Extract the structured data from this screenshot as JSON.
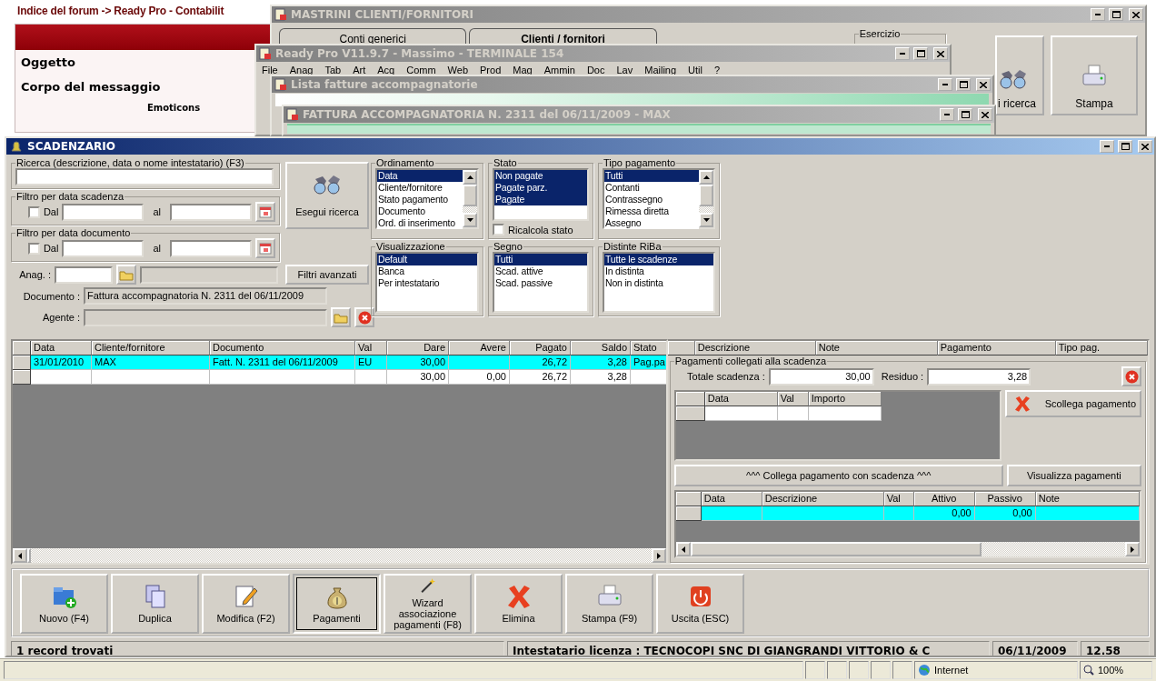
{
  "browser": {
    "breadcrumb": "Indice del forum -> Ready Pro - Contabilit",
    "form_labels": [
      "Oggetto",
      "Corpo del messaggio"
    ],
    "emoticons": "Emoticons",
    "status_zone": "Internet",
    "status_zoom": "100%"
  },
  "mastrini_window": {
    "title": "MASTRINI CLIENTI/FORNITORI",
    "active": false,
    "tabs": [
      {
        "label": "Conti generici",
        "selected": false
      },
      {
        "label": "Clienti / fornitori",
        "selected": true
      }
    ],
    "group": "Esercizio",
    "buttons": [
      {
        "label": "i ricerca",
        "kind": "search"
      },
      {
        "label": "Stampa",
        "kind": "print"
      }
    ]
  },
  "readypro_window": {
    "title": "Ready Pro V11.9.7 - Massimo - TERMINALE 154",
    "active": false,
    "menu": [
      "File",
      "Anag",
      "Tab",
      "Art",
      "Acq",
      "Comm",
      "Web",
      "Prod",
      "Mag",
      "Ammin",
      "Doc",
      "Lav",
      "Mailing",
      "Util",
      "?"
    ]
  },
  "lista_window": {
    "title": "Lista fatture accompagnatorie",
    "active": false
  },
  "fattura_window": {
    "title": "FATTURA ACCOMPAGNATORIA N. 2311  del 06/11/2009 - MAX",
    "active": false
  },
  "scadenzario": {
    "title": "SCADENZARIO",
    "active": true,
    "search": {
      "label": "Ricerca (descrizione, data o nome intestatario) (F3)"
    },
    "date_filters": [
      {
        "label": "Filtro per data scadenza",
        "checked": false,
        "from": "Dal",
        "to": "al"
      },
      {
        "label": "Filtro per data documento",
        "checked": false,
        "from": "Dal",
        "to": "al"
      }
    ],
    "search_button": "Esegui ricerca",
    "anag_label": "Anag. :",
    "advanced_button": "Filtri avanzati",
    "documento": {
      "label": "Documento :",
      "value": "Fattura accompagnatoria N. 2311 del 06/11/2009"
    },
    "agente_label": "Agente :",
    "lists": [
      {
        "title": "Ordinamento",
        "scroll": true,
        "items": [
          {
            "label": "Data",
            "selected": true
          },
          {
            "label": "Cliente/fornitore",
            "selected": false
          },
          {
            "label": "Stato pagamento",
            "selected": false
          },
          {
            "label": "Documento",
            "selected": false
          },
          {
            "label": "Ord. di inserimento",
            "selected": false
          }
        ]
      },
      {
        "title": "Stato",
        "scroll": false,
        "items": [
          {
            "label": "Non pagate",
            "selected": true
          },
          {
            "label": "Pagate parz.",
            "selected": true
          },
          {
            "label": "Pagate",
            "selected": true
          }
        ],
        "checkbox": {
          "label": "Ricalcola stato",
          "checked": false
        }
      },
      {
        "title": "Tipo pagamento",
        "scroll": true,
        "items": [
          {
            "label": "Tutti",
            "selected": true
          },
          {
            "label": "Contanti",
            "selected": false
          },
          {
            "label": "Contrassegno",
            "selected": false
          },
          {
            "label": "Rimessa diretta",
            "selected": false
          },
          {
            "label": "Assegno",
            "selected": false
          }
        ]
      },
      {
        "title": "Visualizzazione",
        "scroll": false,
        "items": [
          {
            "label": "Default",
            "selected": true
          },
          {
            "label": "Banca",
            "selected": false
          },
          {
            "label": "Per intestatario",
            "selected": false
          }
        ]
      },
      {
        "title": "Segno",
        "scroll": false,
        "items": [
          {
            "label": "Tutti",
            "selected": true
          },
          {
            "label": "Scad. attive",
            "selected": false
          },
          {
            "label": "Scad. passive",
            "selected": false
          }
        ]
      },
      {
        "title": "Distinte RiBa",
        "scroll": false,
        "items": [
          {
            "label": "Tutte le scadenze",
            "selected": true
          },
          {
            "label": "In distinta",
            "selected": false
          },
          {
            "label": "Non in distinta",
            "selected": false
          }
        ]
      }
    ],
    "grid": {
      "columns": [
        "Data",
        "Cliente/fornitore",
        "Documento",
        "Val",
        "Dare",
        "Avere",
        "Pagato",
        "Saldo",
        "Stato"
      ],
      "extra_columns": [
        "Descrizione",
        "Note",
        "Pagamento",
        "Tipo pag."
      ],
      "rows": [
        {
          "selected": true,
          "cells": [
            "31/01/2010",
            "MAX",
            "Fatt. N. 2311 del 06/11/2009",
            "EU",
            "30,00",
            null,
            "26,72",
            "3,28",
            "Pag.pa"
          ]
        },
        {
          "selected": false,
          "cells": [
            null,
            null,
            null,
            null,
            "30,00",
            "0,00",
            "26,72",
            "3,28",
            null
          ]
        }
      ]
    },
    "payments": {
      "title": "Pagamenti collegati alla scadenza",
      "total_label": "Totale scadenza :",
      "total": "30,00",
      "residual_label": "Residuo :",
      "residual": "3,28",
      "linked_columns": [
        "Data",
        "Val",
        "Importo"
      ],
      "unlink_button": "Scollega pagamento",
      "link_button": "^^^ Collega pagamento con scadenza ^^^",
      "view_button": "Visualizza pagamenti",
      "payment_columns": [
        "Data",
        "Descrizione",
        "Val",
        "Attivo",
        "Passivo",
        "Note"
      ],
      "payment_rows": [
        {
          "selected": true,
          "cells": [
            null,
            null,
            null,
            "0,00",
            "0,00",
            null
          ]
        }
      ]
    },
    "toolbar": [
      {
        "label": "Nuovo (F4)",
        "kind": "new",
        "selected": false
      },
      {
        "label": "Duplica",
        "kind": "copy",
        "selected": false
      },
      {
        "label": "Modifica (F2)",
        "kind": "edit",
        "selected": false
      },
      {
        "label": "Pagamenti",
        "kind": "money",
        "selected": true
      },
      {
        "label": "Wizard associazione pagamenti (F8)",
        "kind": "wizard",
        "selected": false
      },
      {
        "label": "Elimina",
        "kind": "delete",
        "selected": false
      },
      {
        "label": "Stampa (F9)",
        "kind": "print",
        "selected": false
      },
      {
        "label": "Uscita (ESC)",
        "kind": "exit",
        "selected": false
      }
    ],
    "status": [
      "1 record trovati",
      "Intestatario licenza : TECNOCOPI SNC DI GIANGRANDI VITTORIO & C",
      "06/11/2009",
      "12.58"
    ]
  }
}
